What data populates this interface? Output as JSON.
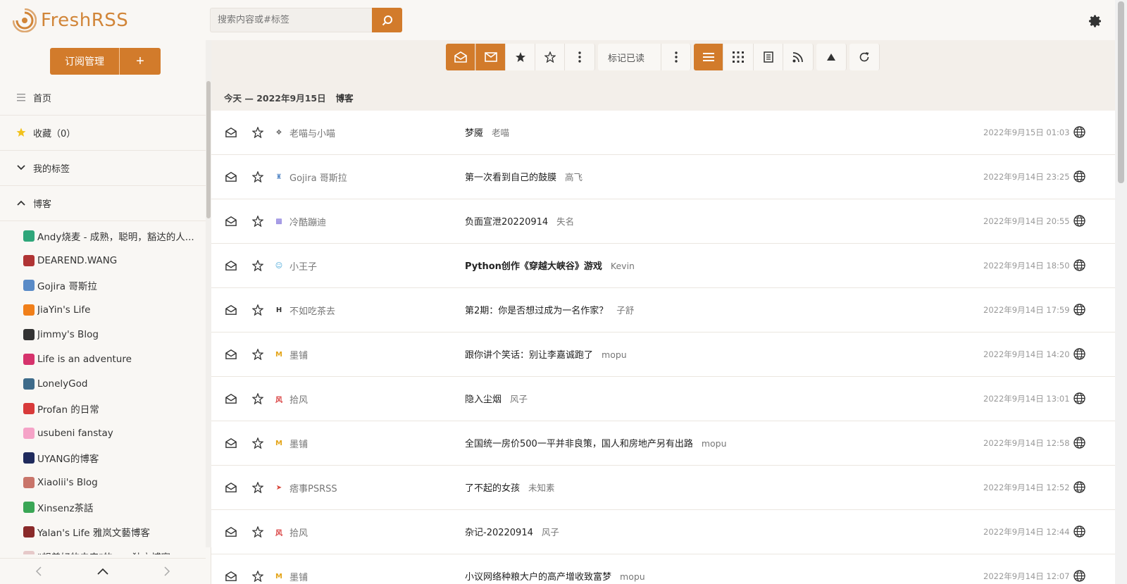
{
  "app": {
    "name": "FreshRSS"
  },
  "search": {
    "placeholder": "搜索内容或#标签"
  },
  "sidebar": {
    "manage_label": "订阅管理",
    "add_label": "+",
    "nav": [
      {
        "label": "首页"
      },
      {
        "label": "收藏（0）"
      },
      {
        "label": "我的标签"
      },
      {
        "label": "博客"
      }
    ],
    "feeds": [
      {
        "name": "Andy烧麦 - 成熟，聪明，豁达的人...",
        "color": "#2fa67a"
      },
      {
        "name": "DEAREND.WANG",
        "color": "#b03434"
      },
      {
        "name": "Gojira 哥斯拉",
        "color": "#5a8bc7"
      },
      {
        "name": "JiaYin's Life",
        "color": "#f07f1a"
      },
      {
        "name": "Jimmy's Blog",
        "color": "#333333"
      },
      {
        "name": "Life is an adventure",
        "color": "#d6336c"
      },
      {
        "name": "LonelyGod",
        "color": "#3e6b8a"
      },
      {
        "name": "Profan 的日常",
        "color": "#d83a3a"
      },
      {
        "name": "usubeni fanstay",
        "color": "#f5a3c7"
      },
      {
        "name": "UYANG的博客",
        "color": "#1f2a5c"
      },
      {
        "name": "Xiaolii's Blog",
        "color": "#c9756a"
      },
      {
        "name": "Xinsenz茶話",
        "color": "#3aa655"
      },
      {
        "name": "Yalan's Life 雅岚文藝博客",
        "color": "#8a2a2a"
      },
      {
        "name": "\"想美好的未来\"的 ---- 独立博客",
        "color": "#e6c9c9"
      }
    ]
  },
  "toolbar": {
    "mark_read_label": "标记已读"
  },
  "date_bar": {
    "date": "今天 — 2022年9月15日",
    "category": "博客"
  },
  "articles": [
    {
      "source": "老喵与小喵",
      "title": "梦魇",
      "author": "老喵",
      "date": "2022年9月15日 01:03",
      "bold": false,
      "icon_color": "#666666",
      "icon_char": "❖"
    },
    {
      "source": "Gojira 哥斯拉",
      "title": "第一次看到自己的鼓膜",
      "author": "高飞",
      "date": "2022年9月14日 23:25",
      "bold": false,
      "icon_color": "#5a8bc7",
      "icon_char": "♜"
    },
    {
      "source": "冷酷蹦迪",
      "title": "负面宣泄20220914",
      "author": "失名",
      "date": "2022年9月14日 20:55",
      "bold": false,
      "icon_color": "#7a6bd8",
      "icon_char": "▩"
    },
    {
      "source": "小王子",
      "title": "Python创作《穿越大峡谷》游戏",
      "author": "Kevin",
      "date": "2022年9月14日 18:50",
      "bold": true,
      "icon_color": "#4aa8d8",
      "icon_char": "☺"
    },
    {
      "source": "不如吃茶去",
      "title": "第2期：你是否想过成为一名作家？",
      "author": "子舒",
      "date": "2022年9月14日 17:59",
      "bold": false,
      "icon_color": "#333333",
      "icon_char": "H"
    },
    {
      "source": "墨铺",
      "title": "跟你讲个笑话：别让李嘉诚跑了",
      "author": "mopu",
      "date": "2022年9月14日 14:20",
      "bold": false,
      "icon_color": "#e4a51a",
      "icon_char": "M"
    },
    {
      "source": "拾风",
      "title": "隐入尘烟",
      "author": "风子",
      "date": "2022年9月14日 13:01",
      "bold": false,
      "icon_color": "#d83a3a",
      "icon_char": "风"
    },
    {
      "source": "墨铺",
      "title": "全国统一房价500一平并非良策，国人和房地产另有出路",
      "author": "mopu",
      "date": "2022年9月14日 12:58",
      "bold": false,
      "icon_color": "#e4a51a",
      "icon_char": "M"
    },
    {
      "source": "痞事PSRSS",
      "title": "了不起的女孩",
      "author": "未知素",
      "date": "2022年9月14日 12:52",
      "bold": false,
      "icon_color": "#d8453a",
      "icon_char": "➤"
    },
    {
      "source": "拾风",
      "title": "杂记-20220914",
      "author": "风子",
      "date": "2022年9月14日 12:44",
      "bold": false,
      "icon_color": "#d83a3a",
      "icon_char": "风"
    },
    {
      "source": "墨铺",
      "title": "小议网络种粮大户的高产增收致富梦",
      "author": "mopu",
      "date": "2022年9月14日 12:07",
      "bold": false,
      "icon_color": "#e4a51a",
      "icon_char": "M"
    }
  ],
  "colors": {
    "accent": "#d27b2b",
    "sidebar_bg": "#f9f7f4"
  }
}
